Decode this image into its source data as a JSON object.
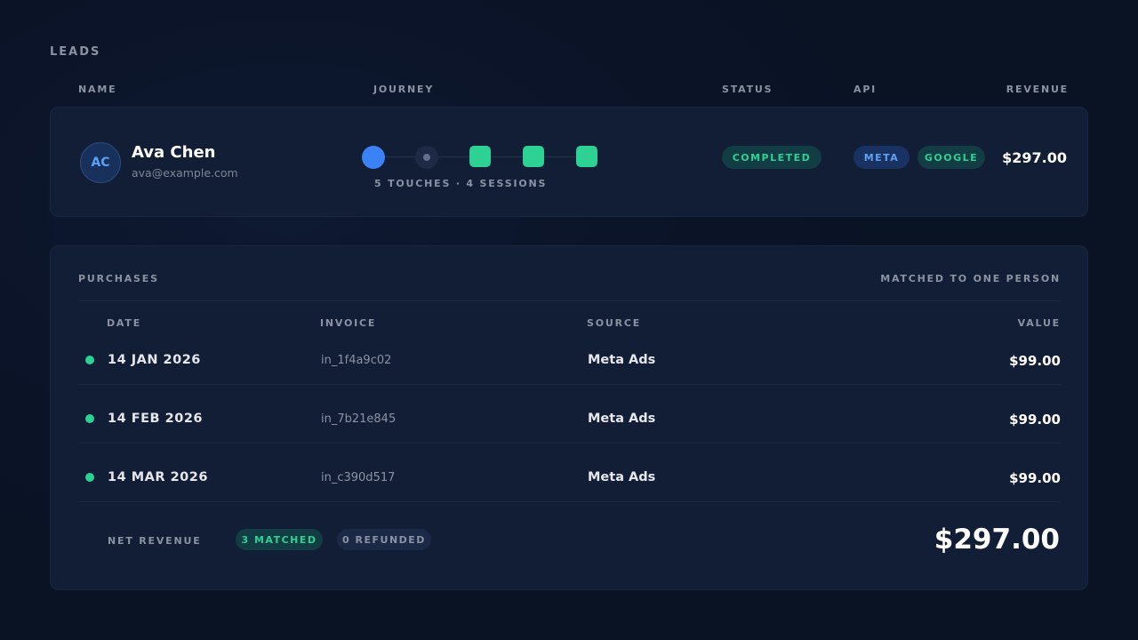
{
  "section_title": "LEADS",
  "columns": {
    "name": "NAME",
    "journey": "JOURNEY",
    "status": "STATUS",
    "api": "API",
    "revenue": "REVENUE"
  },
  "lead": {
    "initials": "AC",
    "name": "Ava Chen",
    "email": "ava@example.com",
    "journey_caption": "5 TOUCHES · 4 SESSIONS",
    "journey_nodes": [
      "start",
      "session",
      "conversion",
      "conversion",
      "conversion"
    ],
    "status": "COMPLETED",
    "api_tags": [
      "META",
      "GOOGLE"
    ],
    "revenue": "$297.00"
  },
  "purchases": {
    "title": "PURCHASES",
    "match_note": "MATCHED TO ONE PERSON",
    "headers": {
      "date": "DATE",
      "invoice": "INVOICE",
      "source": "SOURCE",
      "value": "VALUE"
    },
    "rows": [
      {
        "date": "14 JAN 2026",
        "invoice": "in_1f4a9c02",
        "source": "Meta Ads",
        "value": "$99.00"
      },
      {
        "date": "14 FEB 2026",
        "invoice": "in_7b21e845",
        "source": "Meta Ads",
        "value": "$99.00"
      },
      {
        "date": "14 MAR 2026",
        "invoice": "in_c390d517",
        "source": "Meta Ads",
        "value": "$99.00"
      }
    ],
    "net_label": "NET REVENUE",
    "matched_badge": "3 MATCHED",
    "refunded_badge": "0 REFUNDED",
    "net_total": "$297.00"
  },
  "colors": {
    "accent_blue": "#3b82f6",
    "accent_green": "#2dd193",
    "card_bg": "#121d36",
    "page_bg": "#0a1324"
  }
}
